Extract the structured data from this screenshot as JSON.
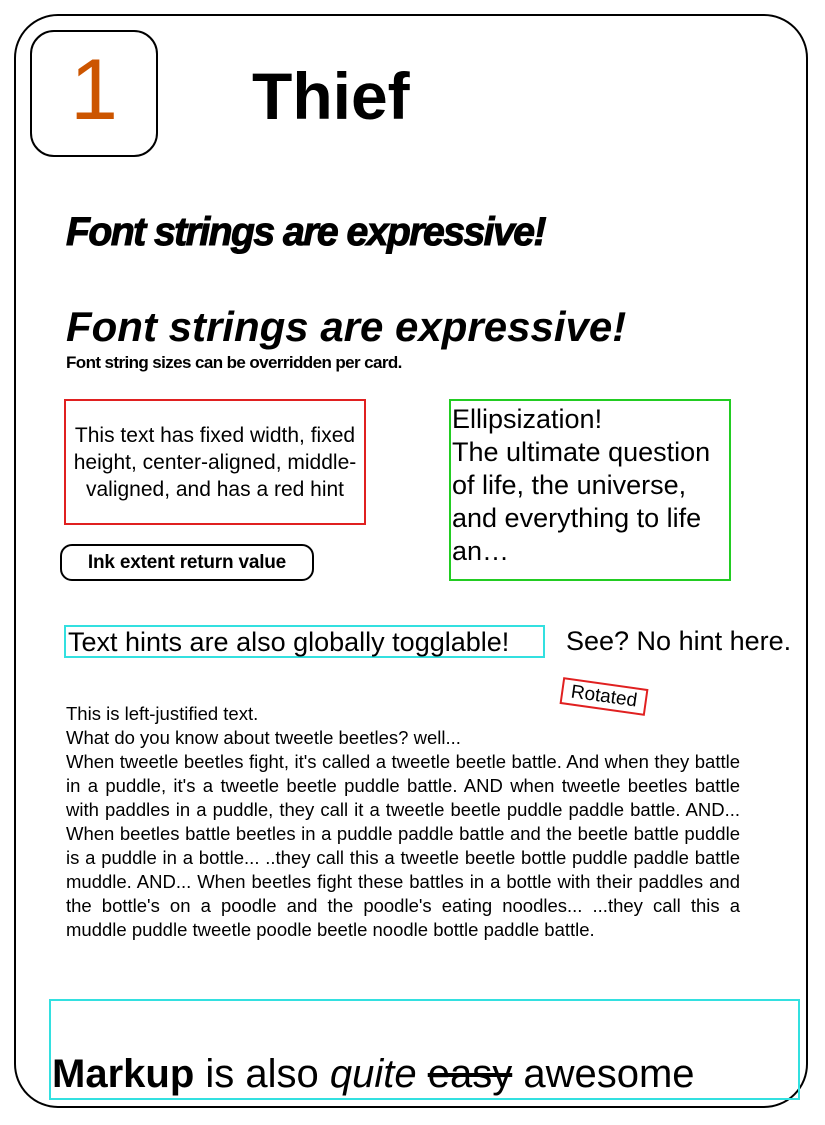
{
  "card": {
    "number": "1",
    "title": "Thief",
    "expressive_condensed": "Font strings are expressive!",
    "expressive_italic": "Font strings are expressive!",
    "sizes_note": "Font string sizes can be overridden per card.",
    "fixed_box_text": "This text has fixed width, fixed height, center-aligned, middle-valigned, and has a red hint",
    "ellipsis_text": "Ellipsization!\nThe ultimate question of life, the universe, and everything to life an…",
    "ink_extent": "Ink extent return value",
    "hint_text": "Text hints are also globally togglable!",
    "no_hint_text": "See? No hint here.",
    "rotated_text": "Rotated",
    "left_line1": "This is left-justified text.",
    "left_line2": "What do you know about tweetle beetles? well...",
    "justified_paragraph": "When tweetle beetles fight, it's called a tweetle beetle battle. And when they battle in a puddle, it's a tweetle beetle puddle battle. AND when tweetle beetles battle with paddles in a puddle, they call it a tweetle beetle puddle paddle battle. AND... When beetles battle beetles in a puddle paddle battle and the beetle battle puddle is a puddle in a bottle... ..they call this a tweetle beetle bottle puddle paddle battle muddle. AND... When beetles fight these battles in a bottle with their paddles and the bottle's on a poodle and the poodle's eating noodles... ...they call this a muddle puddle tweetle poodle beetle noodle bottle paddle battle.",
    "markup": {
      "bold": "Markup",
      "plain1": " is also ",
      "italic": "quite",
      "plain2": " ",
      "strike": "easy",
      "plain3": " awesome"
    }
  },
  "colors": {
    "number": "#cc5500",
    "red_hint": "#e02020",
    "green_hint": "#22cc22",
    "cyan_hint": "#33e0e0"
  }
}
